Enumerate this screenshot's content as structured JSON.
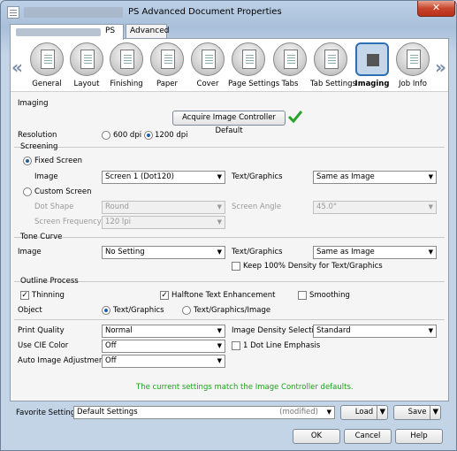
{
  "window": {
    "title": "PS Advanced Document Properties",
    "close": "✕"
  },
  "tabs": [
    "PS",
    "Advanced"
  ],
  "nav": {
    "items": [
      "General",
      "Layout",
      "Finishing",
      "Paper",
      "Cover",
      "Page Settings",
      "Tabs",
      "Tab Settings",
      "Imaging",
      "Job Info"
    ],
    "selected": "Imaging",
    "left_arrow": "«",
    "right_arrow": "»"
  },
  "imaging": {
    "group": "Imaging",
    "acquire_button": "Acquire Image Controller Default",
    "resolution": {
      "label": "Resolution",
      "options": [
        "600 dpi",
        "1200 dpi"
      ],
      "selected": "1200 dpi"
    },
    "screening": {
      "group": "Screening",
      "fixed": "Fixed Screen",
      "image_label": "Image",
      "image_value": "Screen 1 (Dot120)",
      "text_graphics_label": "Text/Graphics",
      "text_graphics_value": "Same as Image",
      "custom": "Custom Screen",
      "dot_shape_label": "Dot Shape",
      "dot_shape_value": "Round",
      "screen_angle_label": "Screen Angle",
      "screen_angle_value": "45.0°",
      "screen_freq_label": "Screen Frequency",
      "screen_freq_value": "120 lpi"
    },
    "tone_curve": {
      "group": "Tone Curve",
      "image_label": "Image",
      "image_value": "No Setting",
      "text_graphics_label": "Text/Graphics",
      "text_graphics_value": "Same as Image",
      "keep_density": "Keep 100% Density for Text/Graphics"
    },
    "outline": {
      "group": "Outline Process",
      "thinning": "Thinning",
      "halftone": "Halftone Text Enhancement",
      "smoothing": "Smoothing",
      "object_label": "Object",
      "object_opt1": "Text/Graphics",
      "object_opt2": "Text/Graphics/Image"
    },
    "print_quality": {
      "label": "Print Quality",
      "value": "Normal"
    },
    "image_density": {
      "label": "Image Density Selection",
      "value": "Standard"
    },
    "cie": {
      "label": "Use CIE Color",
      "value": "Off"
    },
    "dot_line": "1 Dot Line Emphasis",
    "auto_adjust": {
      "label": "Auto Image Adjustment",
      "value": "Off"
    },
    "status": "The current settings match the Image Controller defaults."
  },
  "favorite": {
    "label": "Favorite Setting",
    "value": "Default Settings",
    "state": "(modified)",
    "load": "Load",
    "save": "Save"
  },
  "buttons": {
    "ok": "OK",
    "cancel": "Cancel",
    "help": "Help"
  }
}
